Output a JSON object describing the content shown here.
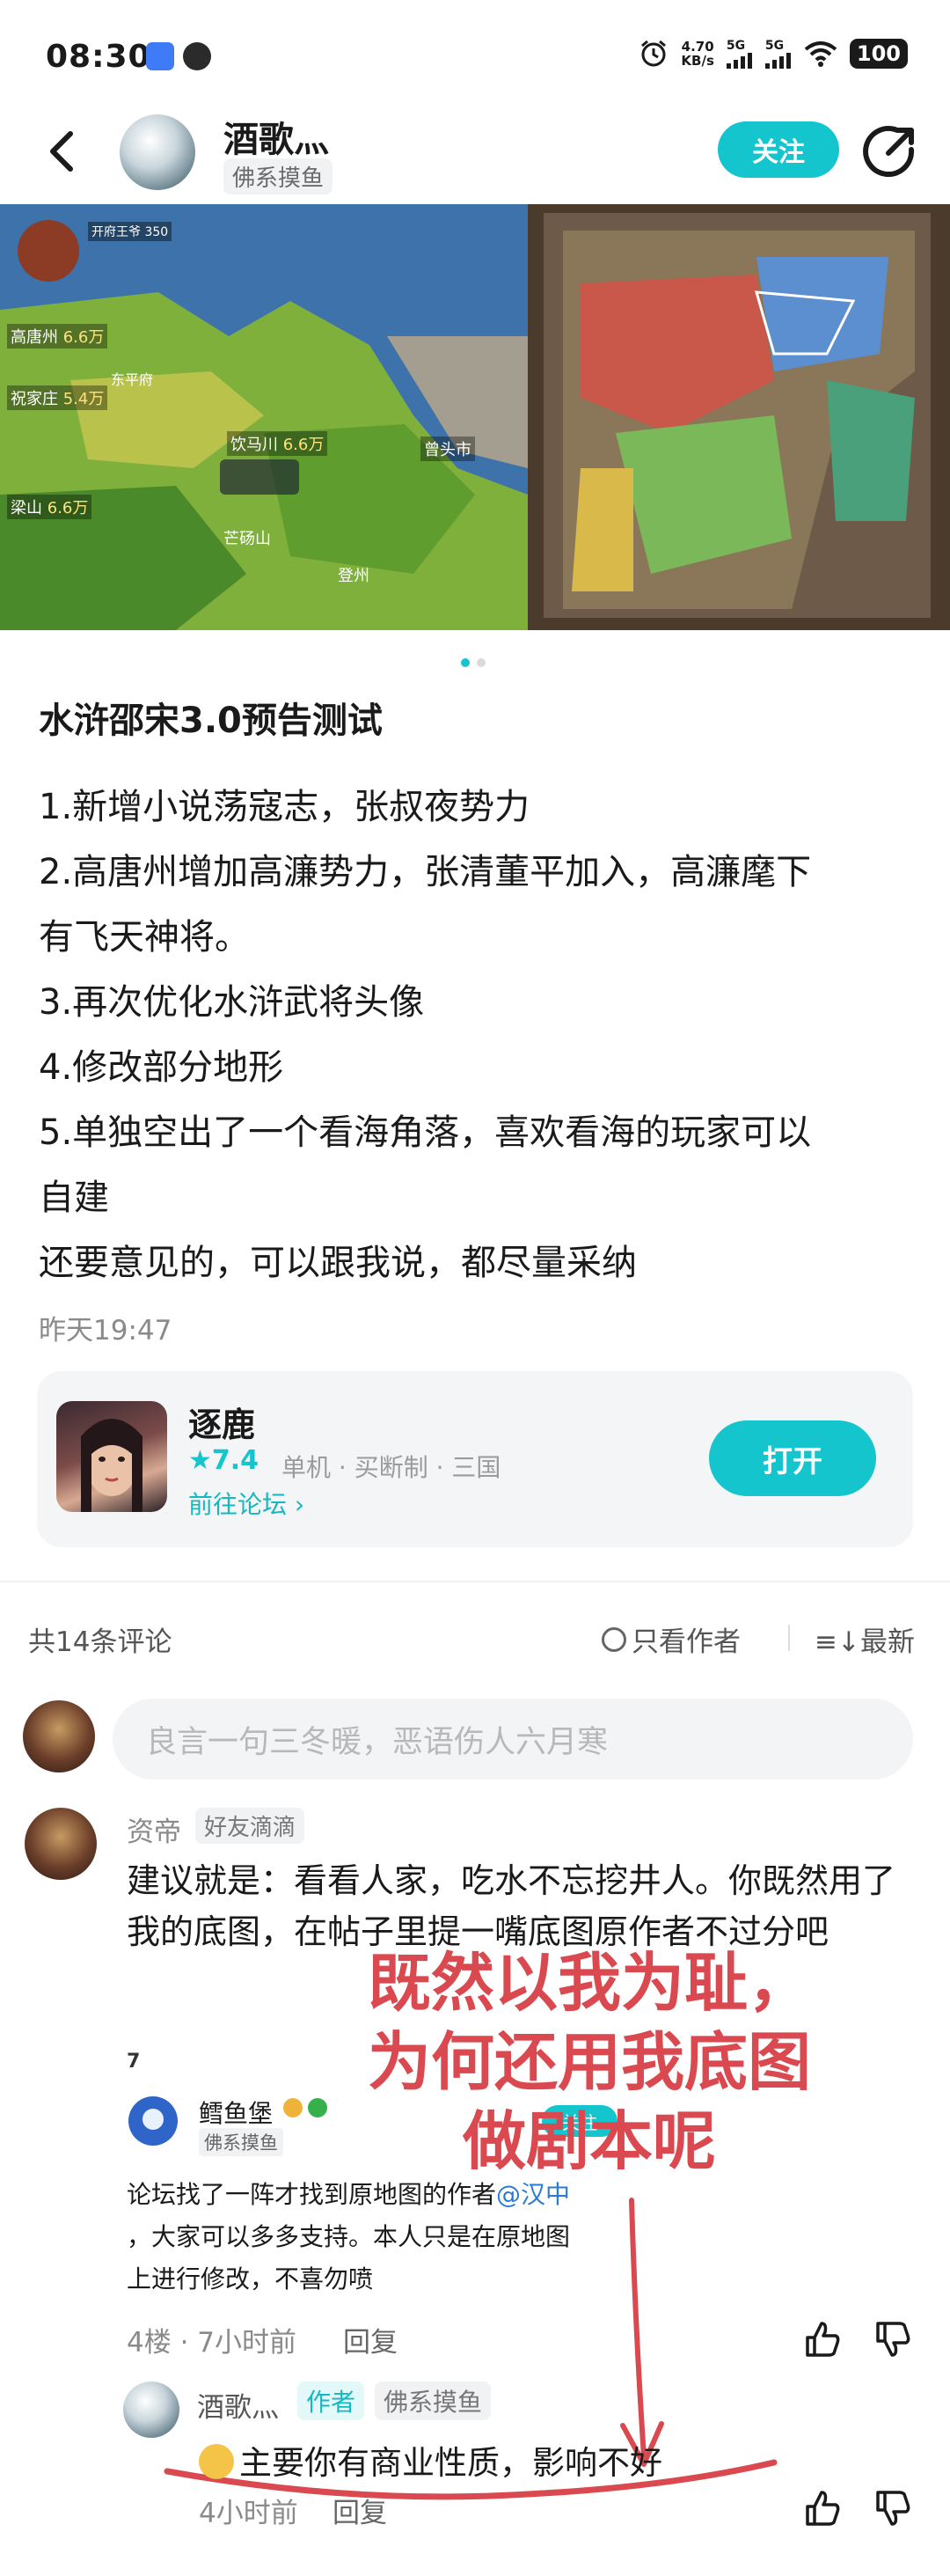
{
  "status_bar": {
    "time": "08:30",
    "net_speed_value": "4.70",
    "net_speed_unit": "KB/s",
    "signal1": "5G",
    "signal2": "5G",
    "battery": "100"
  },
  "header": {
    "author_name": "酒歌灬",
    "author_tag": "佛系摸鱼",
    "follow_label": "关注"
  },
  "banner": {
    "map_labels": {
      "dongping": "东平府",
      "gaotang": "高唐州",
      "zhujiazhuang": "祝家庄",
      "yinmazhou": "饮马川",
      "zengtou": "曾头市",
      "liangshan": "梁山",
      "mangdang": "芒砀山",
      "dengzhou": "登州"
    },
    "values": {
      "gaotang": "6.6万",
      "zhujiazhuang": "5.4万",
      "yinmazhou": "6.6万",
      "liangshan": "6.6万"
    },
    "hud_text": "开府王爷",
    "hud_count": "350",
    "active_slide": 1,
    "slide_count": 2
  },
  "post": {
    "title": "水浒邵宋3.0预告测试",
    "lines": [
      "1.新增小说荡寇志，张叔夜势力",
      "2.高唐州增加高濂势力，张清董平加入，高濂麾下",
      "有飞天神将。",
      "3.再次优化水浒武将头像",
      "4.修改部分地形",
      "5.单独空出了一个看海角落，喜欢看海的玩家可以",
      "自建",
      "还要意见的，可以跟我说，都尽量采纳"
    ],
    "time": "昨天19:47"
  },
  "game_card": {
    "name": "逐鹿",
    "rating": "★7.4",
    "meta": "单机 · 买断制 · 三国",
    "forum_link": "前往论坛 ›",
    "open_label": "打开"
  },
  "comments_header": {
    "count": "共14条评论",
    "only_author": "只看作者",
    "sort_latest": "≡↓最新"
  },
  "comment_input": {
    "placeholder": "良言一句三冬暖，恶语伤人六月寒"
  },
  "comment1": {
    "name": "资帝",
    "tag": "好友滴滴",
    "text": "建议就是：看看人家，吃水不忘挖井人。你既然用了我的底图，在帖子里提一嘴底图原作者不过分吧"
  },
  "quoted": {
    "floor_mark": "7",
    "name": "鳕鱼堡",
    "tag": "佛系摸鱼",
    "follow": "关注",
    "text_before": "论坛找了一阵才找到原地图的作者",
    "mention": "@汉中",
    "text_after_line1": "，大家可以多多支持。本人只是在原地图",
    "text_after_line2": "上进行修改，不喜勿喷"
  },
  "overlay": {
    "line1": "既然以我为耻，",
    "line2": "为何还用我底图",
    "line3": "做剧本呢",
    "color": "#d9494f"
  },
  "floor4": {
    "meta": "4楼 · 7小时前",
    "reply": "回复"
  },
  "author_reply": {
    "name": "酒歌灬",
    "author_tag": "作者",
    "tag": "佛系摸鱼",
    "text": "主要你有商业性质，影响不好",
    "time": "4小时前",
    "reply": "回复"
  },
  "colors": {
    "accent": "#15c5ce",
    "link": "#2b7bd6",
    "annotation": "#d9494f"
  }
}
